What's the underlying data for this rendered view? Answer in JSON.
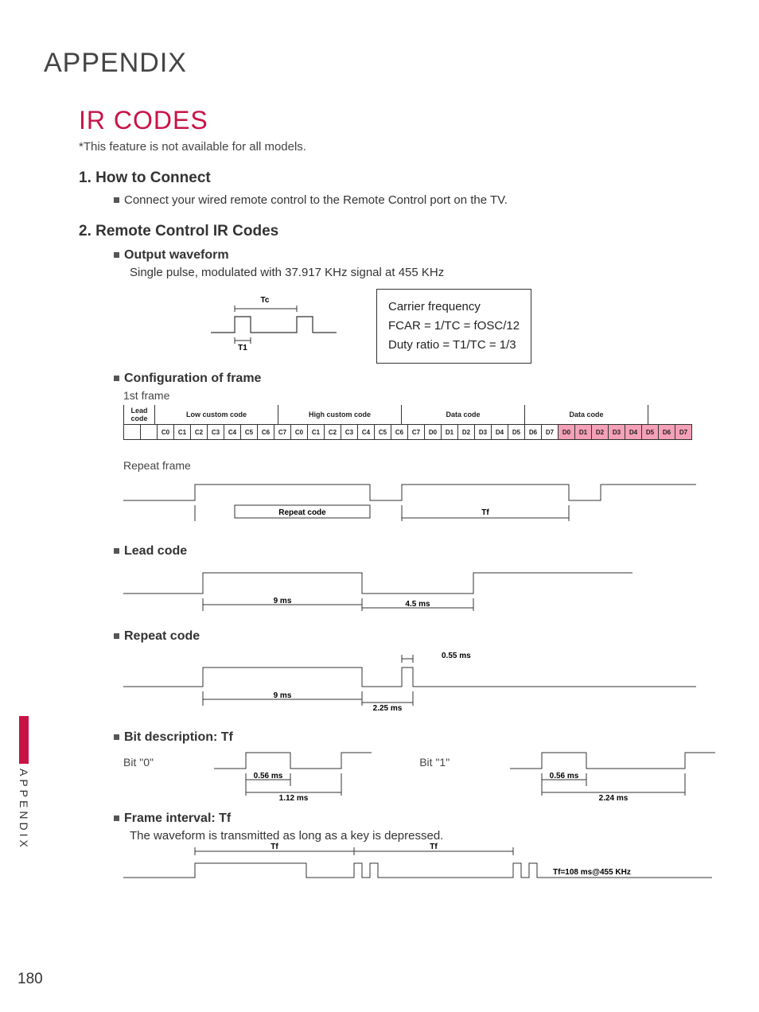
{
  "page_number": "180",
  "side_label": "APPENDIX",
  "appendix": "APPENDIX",
  "title": "IR CODES",
  "note": "*This feature is not available for all models.",
  "s1": {
    "heading": "1.  How to Connect",
    "body": "Connect your wired remote control to the Remote Control port on the TV."
  },
  "s2": {
    "heading": "2. Remote Control IR Codes",
    "output": {
      "heading": "Output waveform",
      "body": "Single pulse, modulated with 37.917 KHz signal at 455 KHz",
      "tc": "Tc",
      "t1": "T1"
    },
    "carrier": {
      "l1": "Carrier frequency",
      "l2": "FCAR = 1/TC = fOSC/12",
      "l3": "Duty ratio = T1/TC = 1/3"
    },
    "config": {
      "heading": "Configuration of frame",
      "first": "1st frame",
      "repeat": "Repeat frame",
      "repeat_code": "Repeat  code",
      "tf": "Tf",
      "labels": {
        "lead": "Lead code",
        "low": "Low custom code",
        "high": "High custom code",
        "data": "Data code"
      },
      "bits": {
        "c": [
          "C0",
          "C1",
          "C2",
          "C3",
          "C4",
          "C5",
          "C6",
          "C7"
        ],
        "d": [
          "D0",
          "D1",
          "D2",
          "D3",
          "D4",
          "D5",
          "D6",
          "D7"
        ]
      }
    },
    "lead": {
      "heading": "Lead code",
      "t9": "9 ms",
      "t45": "4.5 ms"
    },
    "repeat": {
      "heading": "Repeat code",
      "t055": "0.55 ms",
      "t9": "9 ms",
      "t225": "2.25 ms"
    },
    "bit": {
      "heading": "Bit description: Tf",
      "bit0": "Bit \"0\"",
      "bit1": "Bit \"1\"",
      "t056": "0.56 ms",
      "t112": "1.12 ms",
      "t224": "2.24 ms"
    },
    "frame": {
      "heading": "Frame interval: Tf",
      "body": "The waveform is transmitted as long as a key is depressed.",
      "tf": "Tf",
      "tfval": "Tf=108 ms@455 KHz"
    }
  }
}
